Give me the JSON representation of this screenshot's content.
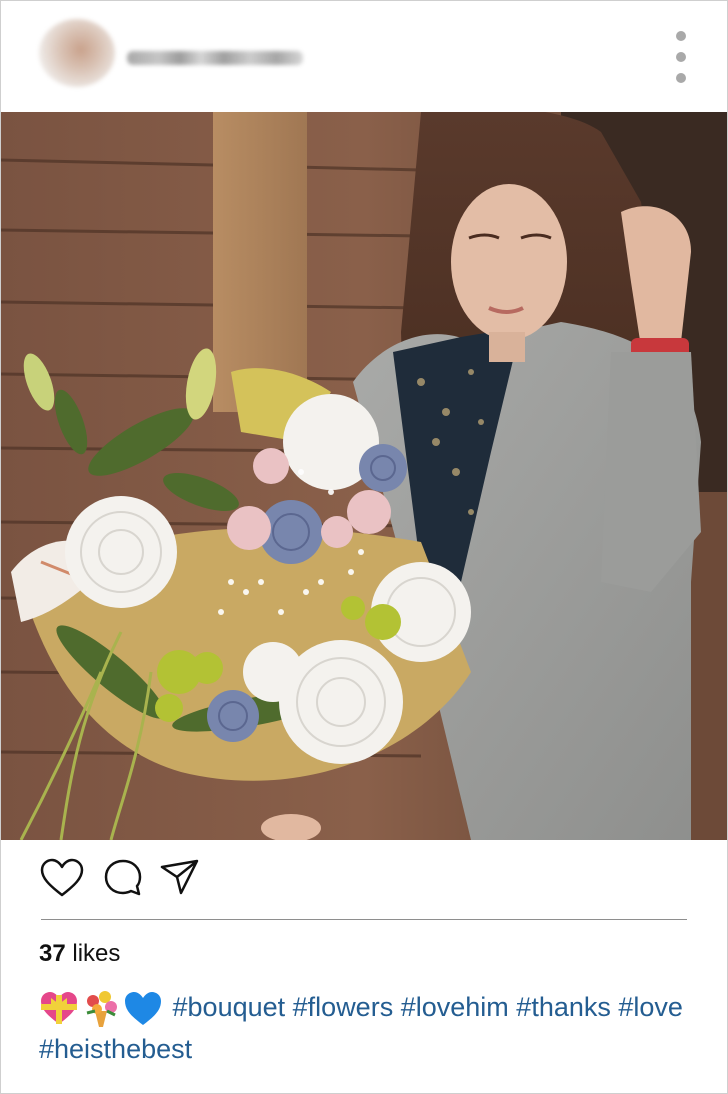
{
  "post": {
    "likes_count": "37",
    "likes_word": "likes",
    "caption_emojis": [
      {
        "name": "heart-with-ribbon"
      },
      {
        "name": "bouquet"
      },
      {
        "name": "blue-heart"
      }
    ],
    "hashtags": [
      "#bouquet",
      "#flowers",
      "#lovehim",
      "#thanks",
      "#love",
      "#heisthebest"
    ]
  },
  "colors": {
    "hashtag": "#245d91",
    "text": "#111111",
    "divider": "#8e8e8e",
    "menu_dots": "#a9a9a9"
  },
  "icons": {
    "like": "heart-icon",
    "comment": "comment-bubble-icon",
    "share": "paper-plane-icon",
    "menu": "more-vertical-icon"
  }
}
